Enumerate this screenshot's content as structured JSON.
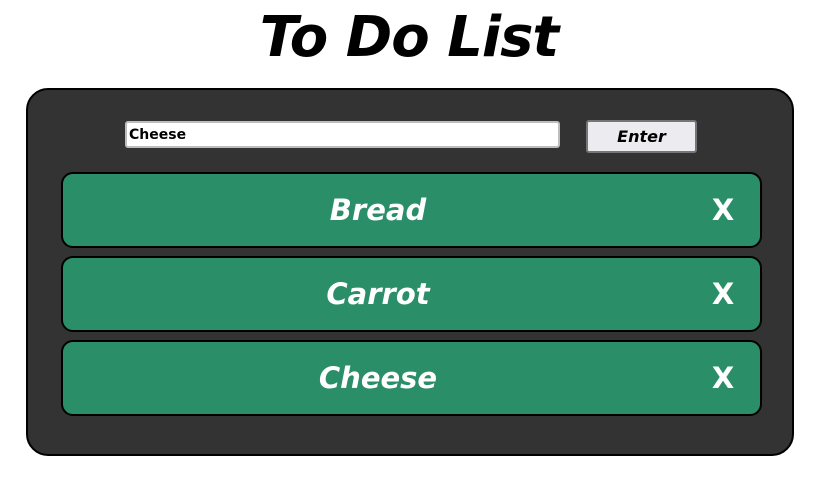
{
  "header": {
    "title": "To Do List"
  },
  "form": {
    "input_value": "Cheese",
    "enter_label": "Enter"
  },
  "items": [
    {
      "label": "Bread",
      "delete_label": "X"
    },
    {
      "label": "Carrot",
      "delete_label": "X"
    },
    {
      "label": "Cheese",
      "delete_label": "X"
    }
  ],
  "colors": {
    "page_background": "#ffffff",
    "panel_background": "#333333",
    "item_background": "#2a8f69",
    "item_text": "#ffffff",
    "border": "#000000"
  }
}
